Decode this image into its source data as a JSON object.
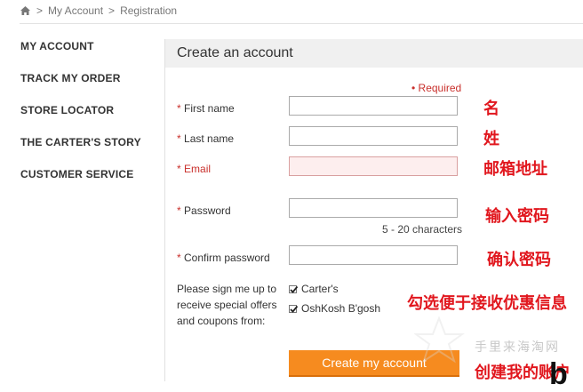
{
  "breadcrumb": {
    "icon": "home-icon",
    "sep1": ">",
    "item1": "My Account",
    "sep2": ">",
    "item2": "Registration"
  },
  "sidebar": {
    "items": [
      {
        "label": "MY ACCOUNT"
      },
      {
        "label": "TRACK MY ORDER"
      },
      {
        "label": "STORE LOCATOR"
      },
      {
        "label": "THE CARTER'S STORY"
      },
      {
        "label": "CUSTOMER SERVICE"
      }
    ]
  },
  "form": {
    "title": "Create an account",
    "required_note": "• Required",
    "star": "*",
    "first_name_label": "First name",
    "last_name_label": "Last name",
    "email_label": "Email",
    "password_label": "Password",
    "password_hint": "5 - 20 characters",
    "confirm_password_label": "Confirm password",
    "first_name_value": "",
    "last_name_value": "",
    "email_value": "",
    "password_value": "",
    "confirm_password_value": "",
    "signup_text": "Please sign me up to receive special offers and coupons from:",
    "checkbox_carters": {
      "label": "Carter's",
      "checked": true
    },
    "checkbox_oshkosh": {
      "label": "OshKosh B'gosh",
      "checked": true
    },
    "submit_label": "Create my account",
    "email_error_bg": "#fdeeee"
  },
  "annotations": {
    "first_name": "名",
    "last_name": "姓",
    "email": "邮箱地址",
    "password": "输入密码",
    "confirm_password": "确认密码",
    "checkbox": "勾选便于接收优惠信息",
    "submit": "创建我的账户",
    "color": "#e1171e"
  },
  "watermark": {
    "text": "手里来海淘网"
  },
  "corner_glyph": "b",
  "colors": {
    "accent_orange": "#f68b1f",
    "required_red": "#c9302c",
    "header_bg": "#f0f0f0"
  }
}
